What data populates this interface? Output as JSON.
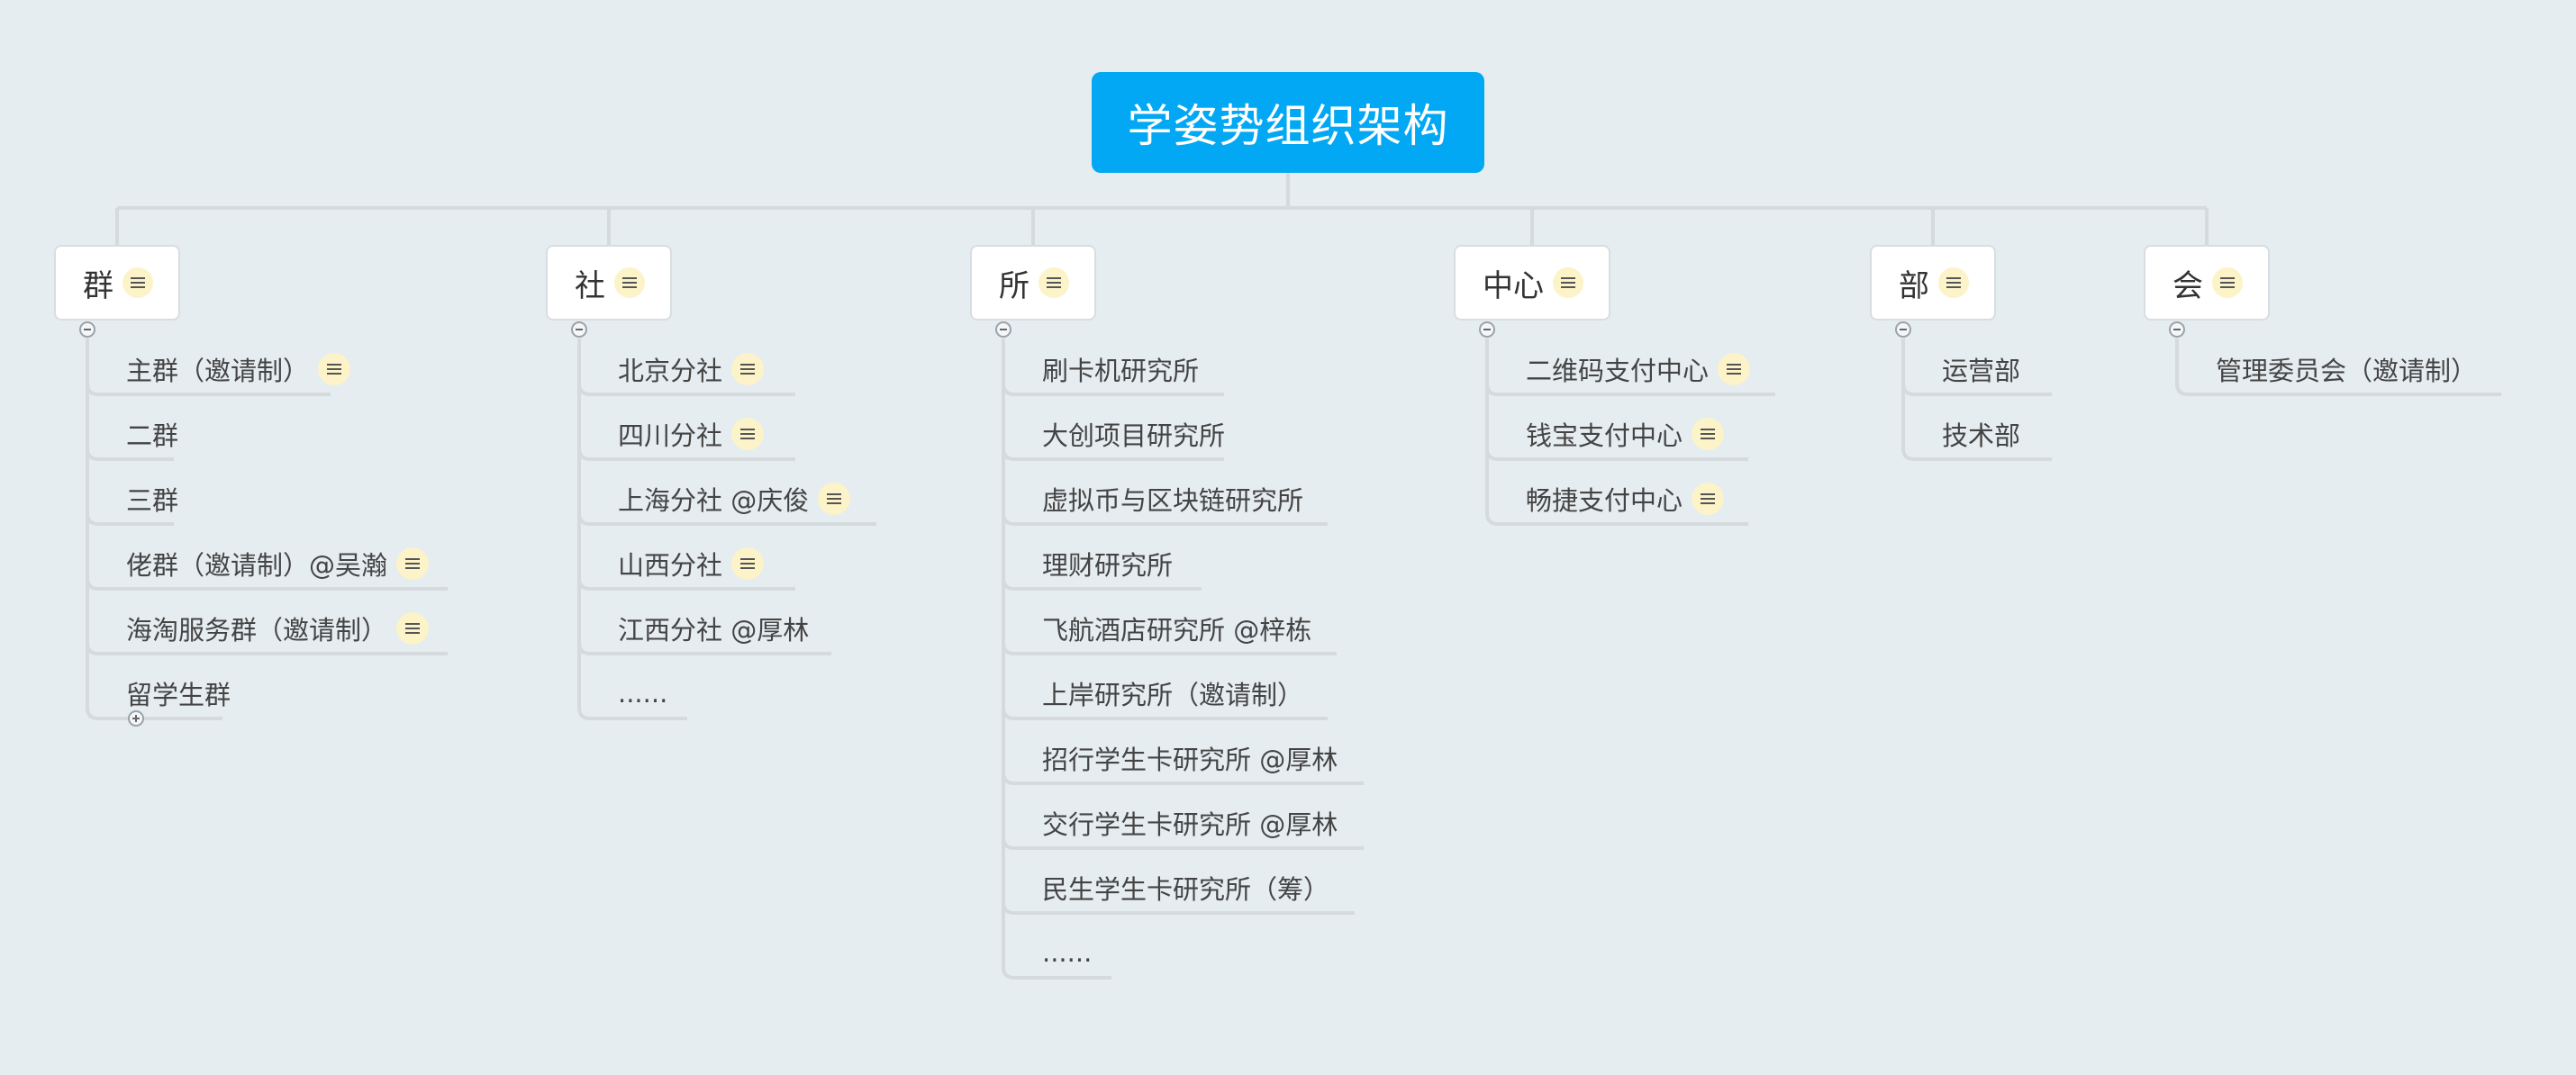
{
  "root": {
    "title": "学姿势组织架构"
  },
  "branches": [
    {
      "label": "群",
      "note": true,
      "children": [
        {
          "label": "主群（邀请制）",
          "note": true
        },
        {
          "label": "二群",
          "note": false
        },
        {
          "label": "三群",
          "note": false
        },
        {
          "label": "佬群（邀请制）@吴瀚",
          "note": true
        },
        {
          "label": "海淘服务群（邀请制）",
          "note": true
        },
        {
          "label": "留学生群",
          "note": false,
          "collapsed": true
        }
      ]
    },
    {
      "label": "社",
      "note": true,
      "children": [
        {
          "label": "北京分社",
          "note": true
        },
        {
          "label": "四川分社",
          "note": true
        },
        {
          "label": "上海分社 @庆俊",
          "note": true
        },
        {
          "label": "山西分社",
          "note": true
        },
        {
          "label": "江西分社 @厚林",
          "note": false
        },
        {
          "label": "......",
          "note": false
        }
      ]
    },
    {
      "label": "所",
      "note": true,
      "children": [
        {
          "label": "刷卡机研究所",
          "note": false
        },
        {
          "label": "大创项目研究所",
          "note": false
        },
        {
          "label": "虚拟币与区块链研究所",
          "note": false
        },
        {
          "label": "理财研究所",
          "note": false
        },
        {
          "label": "飞航酒店研究所 @梓栋",
          "note": false
        },
        {
          "label": "上岸研究所（邀请制）",
          "note": false
        },
        {
          "label": "招行学生卡研究所 @厚林",
          "note": false
        },
        {
          "label": "交行学生卡研究所 @厚林",
          "note": false
        },
        {
          "label": "民生学生卡研究所（筹）",
          "note": false
        },
        {
          "label": "......",
          "note": false
        }
      ]
    },
    {
      "label": "中心",
      "note": true,
      "children": [
        {
          "label": "二维码支付中心",
          "note": true
        },
        {
          "label": "钱宝支付中心",
          "note": true
        },
        {
          "label": "畅捷支付中心",
          "note": true
        }
      ]
    },
    {
      "label": "部",
      "note": true,
      "children": [
        {
          "label": "运营部",
          "note": false
        },
        {
          "label": "技术部",
          "note": false
        }
      ]
    },
    {
      "label": "会",
      "note": true,
      "children": [
        {
          "label": "管理委员会（邀请制）",
          "note": false
        }
      ]
    }
  ],
  "colors": {
    "background": "#e6edf1",
    "root": "#02a8f3",
    "connector": "#d5dadd",
    "note_icon": "#fcf3c8"
  },
  "icons": {
    "note": "note-lines-icon",
    "collapse": "collapse-minus-icon",
    "expand": "expand-plus-icon"
  }
}
